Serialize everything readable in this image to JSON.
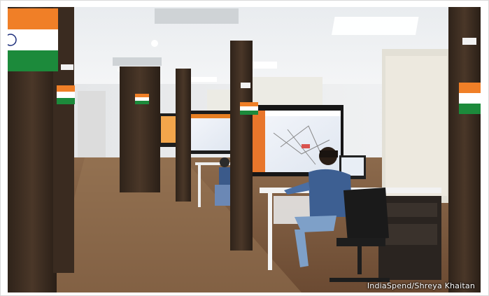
{
  "photo": {
    "alt": "Office room with dark wooden pillars, computer workstations with large monitors, and a man seated at a desk",
    "credit": "IndiaSpend/Shreya Khaitan"
  }
}
